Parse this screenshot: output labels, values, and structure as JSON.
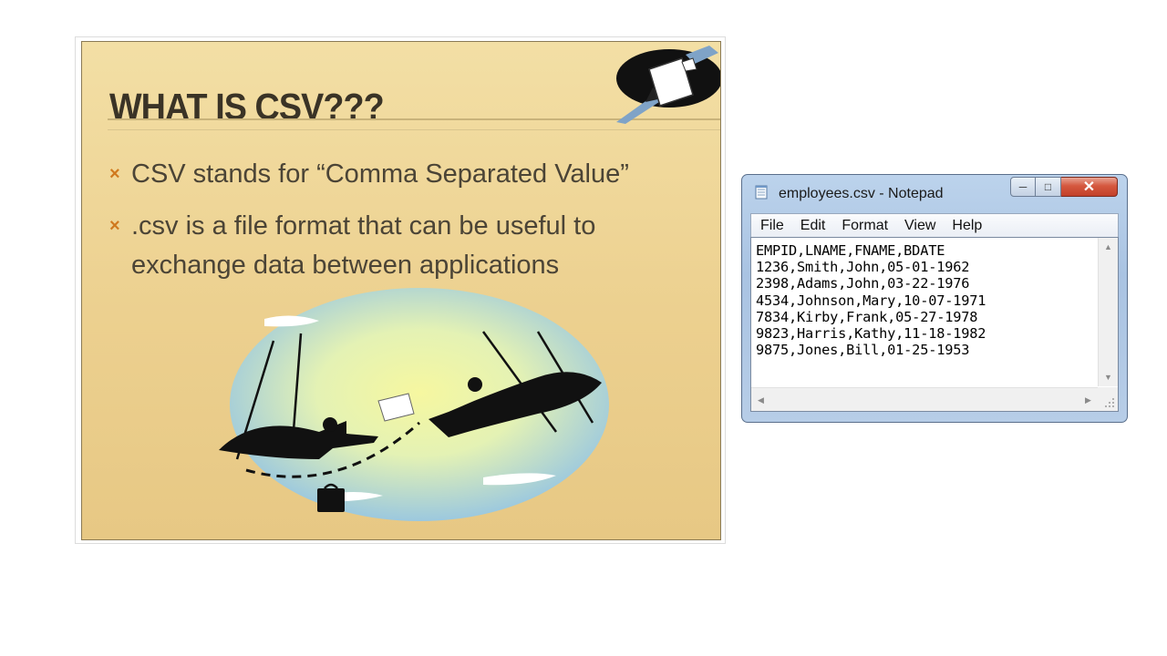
{
  "slide": {
    "title": "WHAT IS CSV???",
    "bullets": [
      "CSV stands for “Comma Separated Value”",
      ".csv is a file format that can be useful to exchange data between applications"
    ],
    "bullet_color": "#d0791f",
    "background_color": "#ecd08f",
    "images": [
      "document-handoff-clipart",
      "trapeze-businessmen-clipart"
    ]
  },
  "notepad": {
    "title": "employees.csv - Notepad",
    "menu": [
      "File",
      "Edit",
      "Format",
      "View",
      "Help"
    ],
    "content_lines": [
      "EMPID,LNAME,FNAME,BDATE",
      "1236,Smith,John,05-01-1962",
      "2398,Adams,John,03-22-1976",
      "4534,Johnson,Mary,10-07-1971",
      "7834,Kirby,Frank,05-27-1978",
      "9823,Harris,Kathy,11-18-1982",
      "9875,Jones,Bill,01-25-1953"
    ],
    "controls": [
      "minimize-icon",
      "maximize-icon",
      "close-icon"
    ],
    "close_color": "#c2402a"
  }
}
